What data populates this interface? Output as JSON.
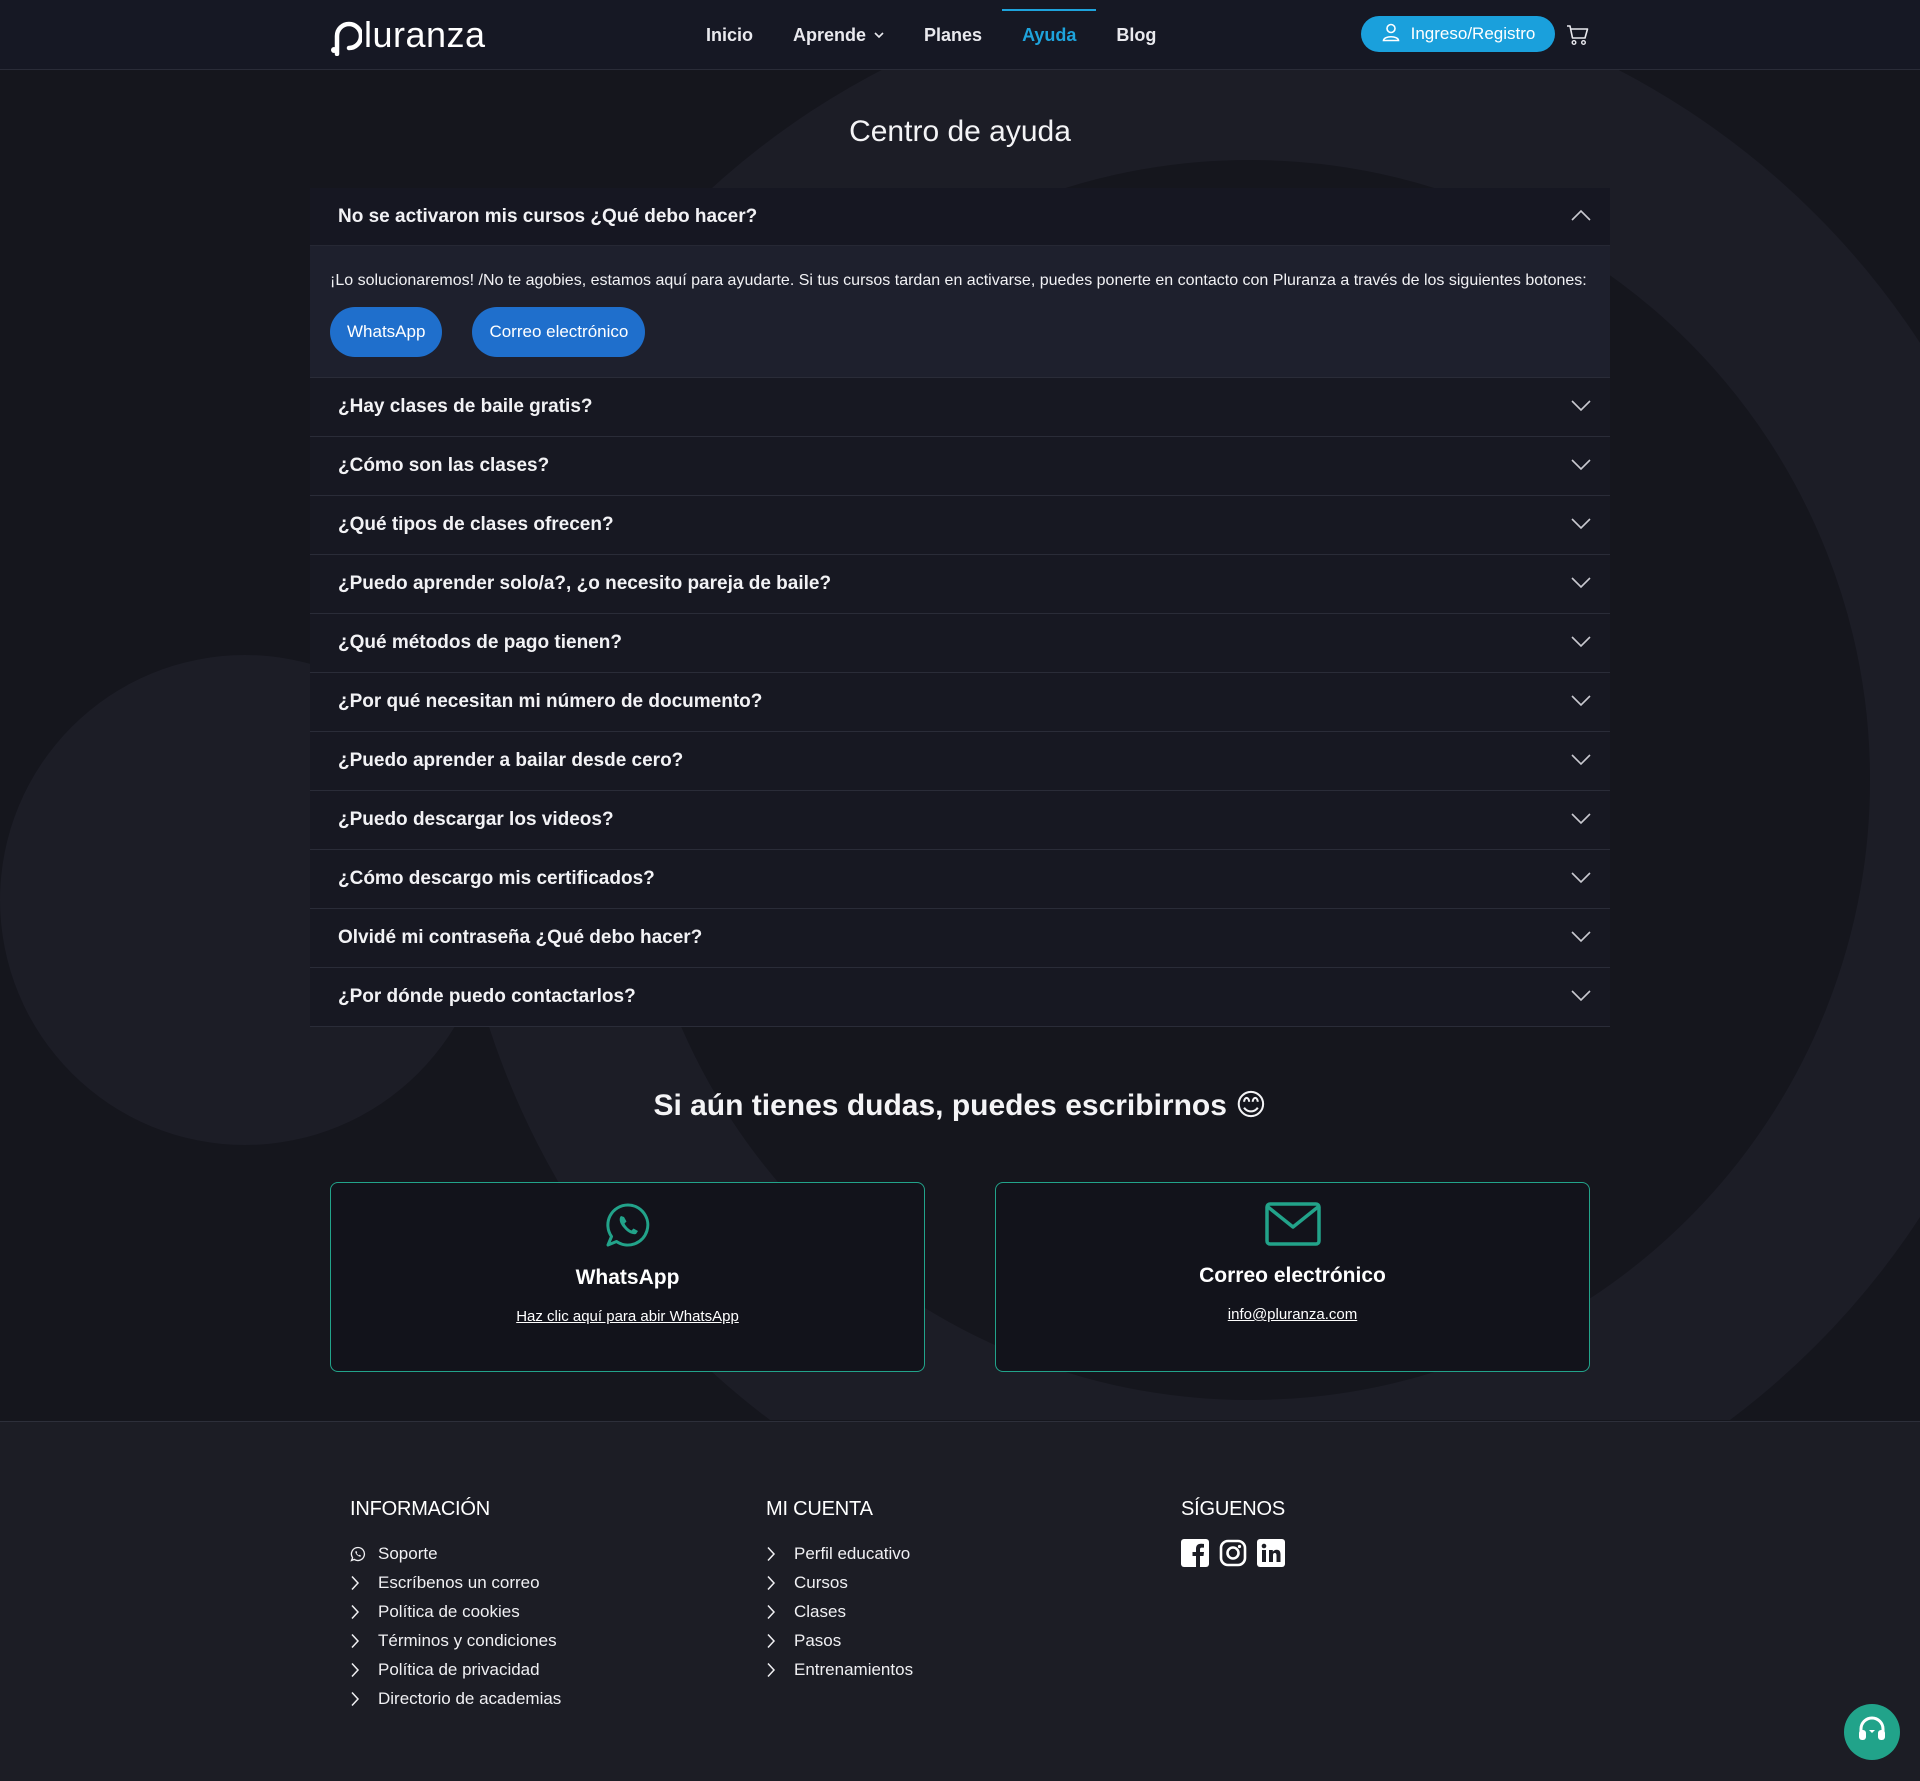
{
  "header": {
    "logo_text": "luranza",
    "nav": [
      {
        "label": "Inicio"
      },
      {
        "label": "Aprende"
      },
      {
        "label": "Planes"
      },
      {
        "label": "Ayuda"
      },
      {
        "label": "Blog"
      }
    ],
    "login_label": "Ingreso/Registro"
  },
  "main": {
    "title": "Centro de ayuda",
    "faq": [
      {
        "question": "No se activaron mis cursos ¿Qué debo hacer?",
        "open": true,
        "answer": "¡Lo solucionaremos! /No te agobies, estamos aquí para ayudarte. Si tus cursos tardan en activarse, puedes ponerte en contacto con Pluranza a través de los siguientes botones:",
        "buttons": [
          "WhatsApp",
          "Correo electrónico"
        ]
      },
      {
        "question": "¿Hay clases de baile gratis?"
      },
      {
        "question": "¿Cómo son las clases?"
      },
      {
        "question": "¿Qué tipos de clases ofrecen?"
      },
      {
        "question": "¿Puedo aprender solo/a?, ¿o necesito pareja de baile?"
      },
      {
        "question": "¿Qué métodos de pago tienen?"
      },
      {
        "question": "¿Por qué necesitan mi número de documento?"
      },
      {
        "question": "¿Puedo aprender a bailar desde cero?"
      },
      {
        "question": "¿Puedo descargar los videos?"
      },
      {
        "question": "¿Cómo descargo mis certificados?"
      },
      {
        "question": "Olvidé mi contraseña ¿Qué debo hacer?"
      },
      {
        "question": "¿Por dónde puedo contactarlos?"
      }
    ],
    "doubts_text": "Si aún tienes dudas, puedes escribirnos 😊",
    "contact_cards": [
      {
        "icon": "whatsapp-icon",
        "title": "WhatsApp",
        "link": "Haz clic aquí para abir WhatsApp"
      },
      {
        "icon": "mail-icon",
        "title": "Correo electrónico",
        "link": "info@pluranza.com"
      }
    ]
  },
  "footer": {
    "info": {
      "heading": "INFORMACIÓN",
      "items": [
        "Soporte",
        "Escríbenos un correo",
        "Política de cookies",
        "Términos y condiciones",
        "Política de privacidad",
        "Directorio de academias"
      ]
    },
    "account": {
      "heading": "MI CUENTA",
      "items": [
        "Perfil educativo",
        "Cursos",
        "Clases",
        "Pasos",
        "Entrenamientos"
      ]
    },
    "social": {
      "heading": "SÍGUENOS",
      "icons": [
        "facebook-icon",
        "instagram-icon",
        "linkedin-icon"
      ]
    }
  },
  "colors": {
    "background": "#15161d",
    "accent_blue": "#1ea3dc",
    "button_blue": "#1f6fcc",
    "accent_green": "#22a38a"
  }
}
